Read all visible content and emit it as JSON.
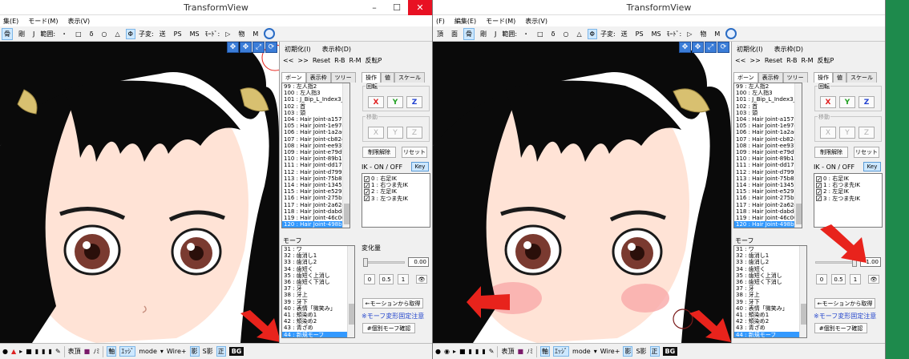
{
  "left": {
    "title": "TransformView",
    "menu": [
      "集(E)",
      "モード(M)",
      "表示(V)"
    ],
    "toolbar": [
      "骨",
      "剛",
      "J",
      "範囲:",
      "・",
      "□",
      "δ",
      "○",
      "△",
      "Φ",
      "子変:",
      "送",
      "PS",
      "MS",
      "ﾓｰﾄﾞ:",
      "▷",
      "物",
      "M"
    ],
    "panel": {
      "nav": [
        "<<",
        ">>",
        "Reset",
        "R-B",
        "R-M",
        "反転P"
      ],
      "menu_row": [
        "初期化(I)",
        "表示枠(D)"
      ],
      "tabs": [
        "ボーン",
        "表示枠",
        "ツリー"
      ],
      "op_tabs": [
        "操作",
        "値",
        "スケール"
      ],
      "rotate_label": "回転",
      "move_label": "移動",
      "axes": [
        "X",
        "Y",
        "Z"
      ],
      "limit_btn": "制限解除",
      "reset_btn": "リセット",
      "ik_label": "IK - ON / OFF",
      "key_btn": "Key",
      "ik_items": [
        "0 : 右足IK",
        "1 : 右つま先IK",
        "2 : 左足IK",
        "3 : 左つま先IK"
      ],
      "bones": [
        "99 : 左人指2",
        "100 : 左人指3",
        "101 : J_Bip_L_Index3_en",
        "102 : 首",
        "103 : 頭",
        "104 : Hair Joint-a15763",
        "105 : Hair Joint-1e97c0",
        "106 : Hair Joint-1a2a69",
        "107 : Hair Joint-cb8244",
        "108 : Hair Joint-ee937c",
        "109 : Hair Joint-e79df9",
        "110 : Hair Joint-89b11d",
        "111 : Hair Joint-dd17bf",
        "112 : Hair Joint-d799d9",
        "113 : Hair Joint-75b85f",
        "114 : Hair Joint-1345dd",
        "115 : Hair Joint-e52975",
        "116 : Hair Joint-275bba",
        "117 : Hair Joint-2a62e0",
        "118 : Hair Joint-dabdc3",
        "119 : Hair Joint-46c009",
        "120 : Hair Joint-498b27"
      ],
      "morph_label": "モーフ",
      "morphs": [
        "31 : ワ",
        "32 : 歯消し1",
        "33 : 歯消し2",
        "34 : 歯短く",
        "35 : 歯短く上消し",
        "36 : 歯短く下消し",
        "37 : 牙",
        "38 : 牙上",
        "39 : 牙下",
        "40 : 表情「微笑み」",
        "41 : 頬染め1",
        "42 : 頬染め2",
        "43 : 青ざめ",
        "44 : 新規モーフ"
      ],
      "change_label": "変化量",
      "morph_value": 0.0,
      "morph_value_text": "0.00",
      "preset_btns": [
        "0",
        "0.5",
        "1"
      ],
      "from_motion_btn": "←モーションから取得",
      "note": "※モーフ変形固定注意",
      "confirm_btn": "#個別モーフ確認"
    },
    "bottombar": [
      "表頂",
      "ﾉﾐ",
      "軸",
      "ｴｯｼﾞ",
      "mode",
      "Wire+",
      "影",
      "S影",
      "正",
      "BG"
    ]
  },
  "right": {
    "title": "TransformView",
    "menu": [
      "(F)",
      "編集(E)",
      "モード(M)",
      "表示(V)"
    ],
    "toolbar": [
      "頂",
      "面",
      "骨",
      "剛",
      "J",
      "範囲:",
      "・",
      "□",
      "δ",
      "○",
      "△",
      "Φ",
      "子変:",
      "送",
      "PS",
      "MS",
      "ﾓｰﾄﾞ:",
      "▷",
      "物",
      "M"
    ],
    "morph_value": 1.0,
    "morph_value_text": "1.00"
  },
  "colors": {
    "accent": "#3399ff",
    "axis_x": "#e02020",
    "axis_y": "#20a020",
    "axis_z": "#2040d0",
    "arrow_red": "#e8231c",
    "taskbar_green": "#1e8a4c"
  }
}
